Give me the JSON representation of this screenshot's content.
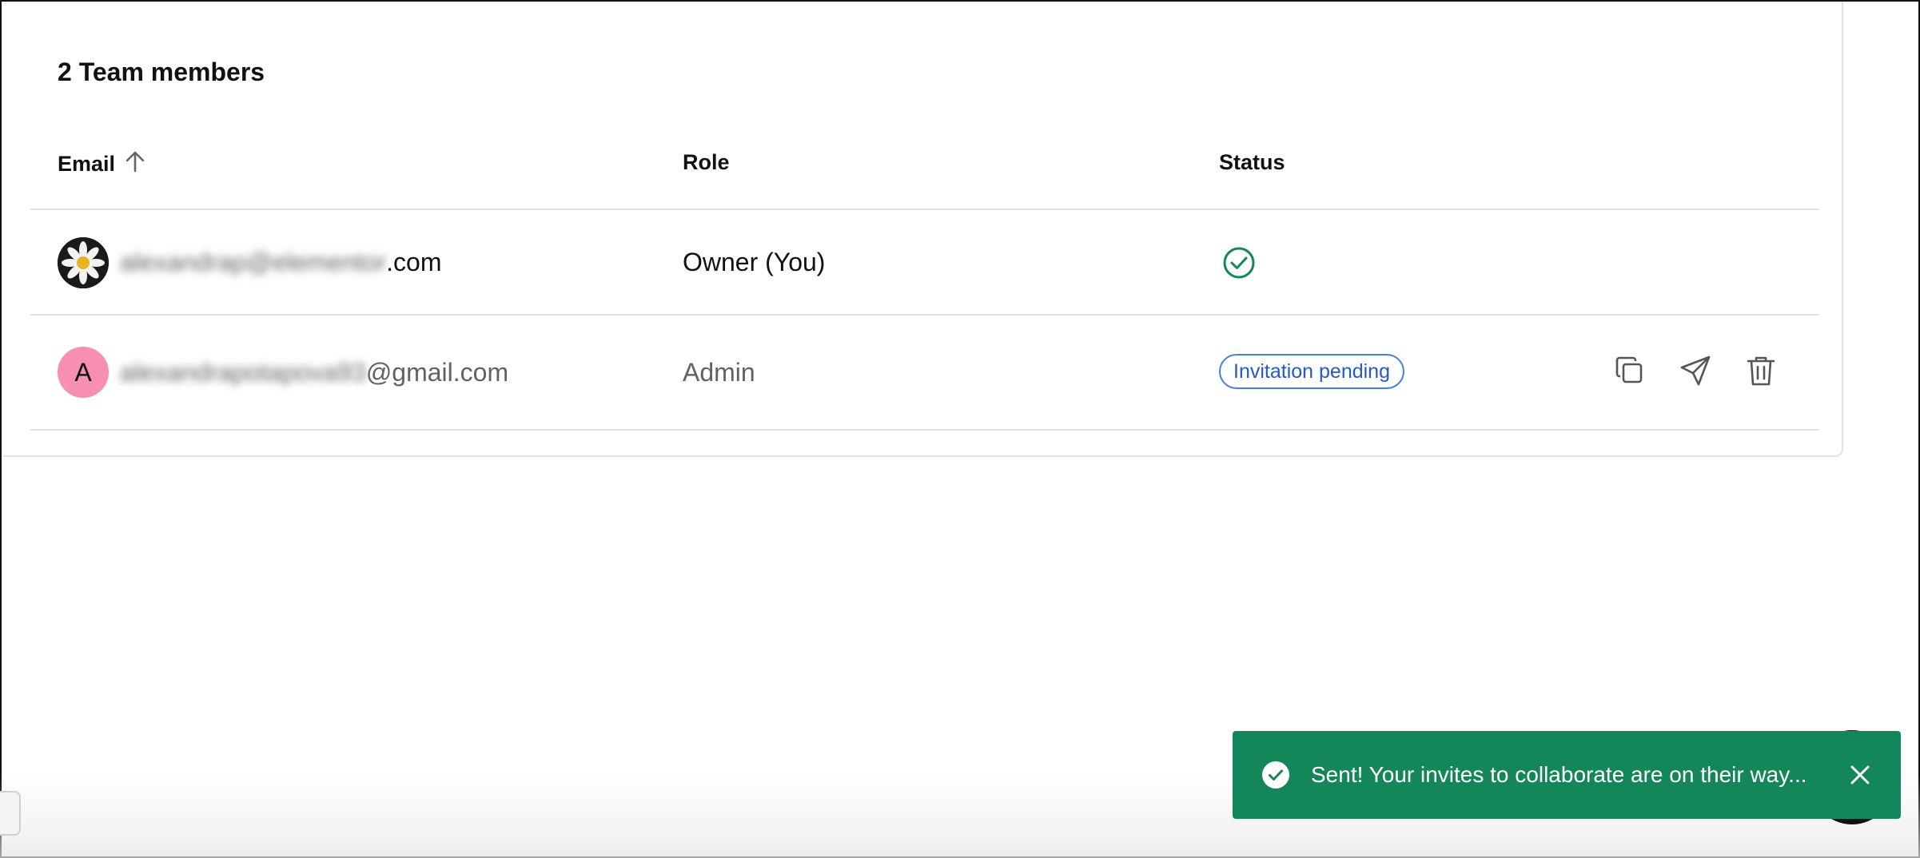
{
  "team": {
    "title": "2 Team members",
    "columns": {
      "email": "Email",
      "role": "Role",
      "status": "Status"
    },
    "sort": {
      "column": "email",
      "direction": "ascending",
      "icon": "arrow-up-icon"
    },
    "members": [
      {
        "avatar_icon": "daisy-photo-avatar",
        "email_blurred": "alexandrap@elementor",
        "email_visible": ".com",
        "role": "Owner (You)",
        "status_icon": "check-circle-icon"
      },
      {
        "avatar_letter": "A",
        "avatar_color": "#f78fb3",
        "email_blurred": "alexandrapotapova93",
        "email_visible": "@gmail.com",
        "role": "Admin",
        "status": "Invitation pending",
        "actions": [
          "copy-icon",
          "send-icon",
          "trash-icon"
        ]
      }
    ]
  },
  "toast": {
    "message": "Sent! Your invites to collaborate are on their way...",
    "icon": "check-circle-icon",
    "close_icon": "close-icon",
    "color": "#14875a"
  },
  "colors": {
    "accent": "#2459c6",
    "success": "#14875a"
  }
}
